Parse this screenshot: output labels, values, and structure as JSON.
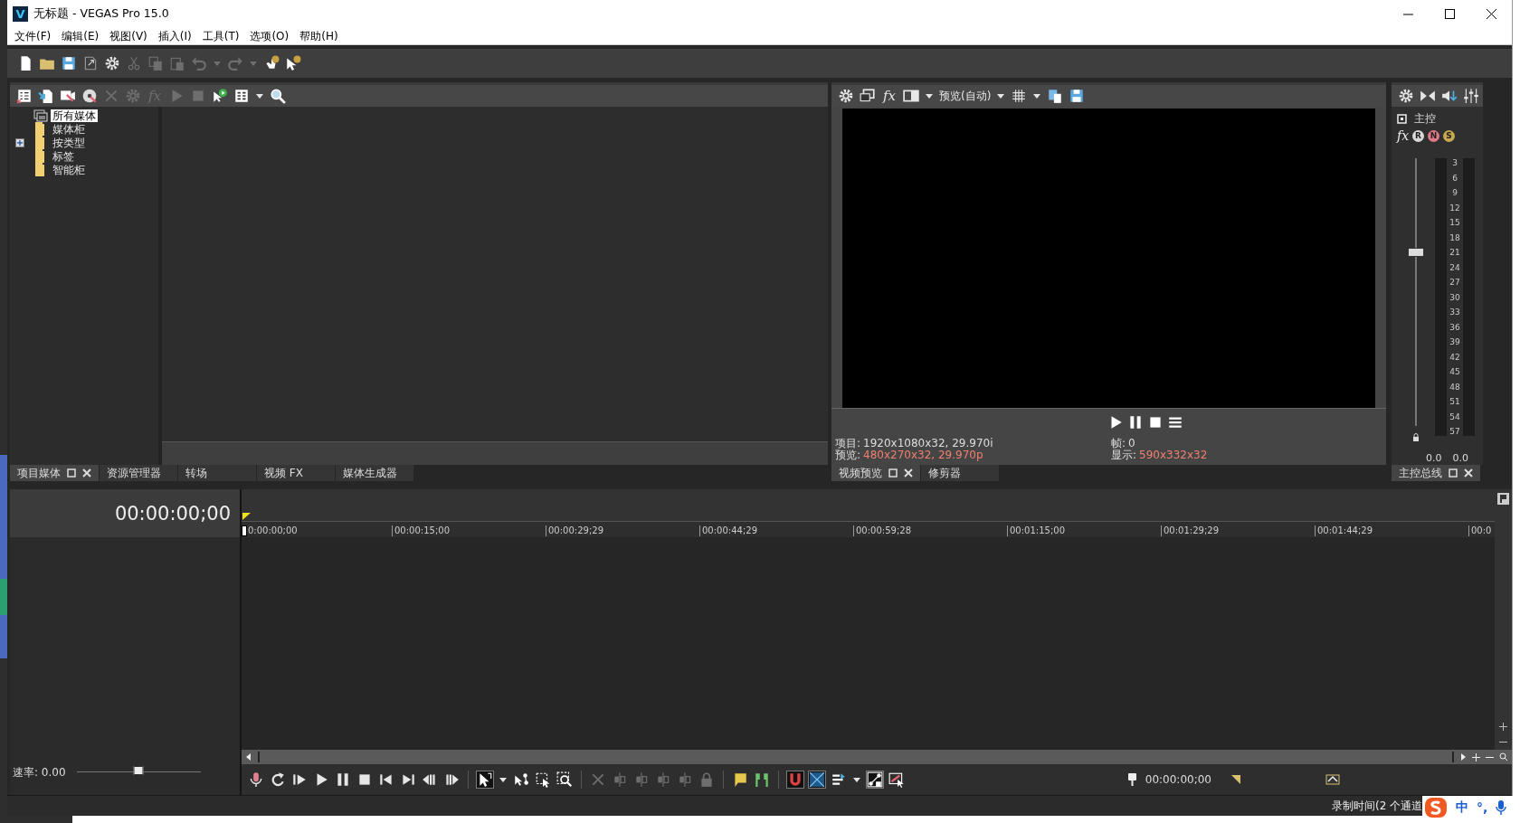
{
  "window": {
    "logo": "V",
    "title": "无标题 - VEGAS Pro 15.0"
  },
  "menu": [
    "文件(F)",
    "编辑(E)",
    "视图(V)",
    "插入(I)",
    "工具(T)",
    "选项(O)",
    "帮助(H)"
  ],
  "main_toolbar": [
    {
      "kind": "new",
      "disabled": false
    },
    {
      "kind": "open",
      "disabled": false
    },
    {
      "kind": "save",
      "disabled": false
    },
    {
      "kind": "render",
      "disabled": false
    },
    {
      "kind": "gear",
      "disabled": false
    },
    {
      "kind": "cut",
      "disabled": true
    },
    {
      "kind": "copy",
      "disabled": true
    },
    {
      "kind": "paste",
      "disabled": true
    },
    {
      "kind": "undo",
      "disabled": true
    },
    {
      "kind": "caret",
      "disabled": true
    },
    {
      "kind": "redo",
      "disabled": true
    },
    {
      "kind": "caret",
      "disabled": true
    },
    {
      "kind": "helphand",
      "disabled": false
    },
    {
      "kind": "helpptr",
      "disabled": false
    }
  ],
  "media_panel": {
    "toolbar": [
      {
        "kind": "list",
        "disabled": false
      },
      {
        "kind": "import",
        "disabled": false
      },
      {
        "kind": "capture",
        "disabled": false
      },
      {
        "kind": "disc",
        "disabled": false
      },
      {
        "kind": "delete",
        "disabled": true
      },
      {
        "kind": "gear",
        "disabled": true
      },
      {
        "kind": "fx",
        "label": "fx",
        "disabled": true
      },
      {
        "kind": "play",
        "disabled": true
      },
      {
        "kind": "stop",
        "disabled": true
      },
      {
        "kind": "autopreview",
        "disabled": false
      },
      {
        "kind": "views",
        "disabled": false
      },
      {
        "kind": "caret",
        "disabled": false
      },
      {
        "kind": "search",
        "disabled": false
      }
    ],
    "tree": [
      {
        "label": "所有媒体",
        "kind": "root",
        "selected": true
      },
      {
        "label": "媒体柜",
        "kind": "folder",
        "selected": false
      },
      {
        "label": "按类型",
        "kind": "folder",
        "selected": false,
        "expanded": false
      },
      {
        "label": "标签",
        "kind": "folder",
        "selected": false
      },
      {
        "label": "智能柜",
        "kind": "folder",
        "selected": false
      }
    ],
    "tabs": [
      {
        "label": "项目媒体",
        "selected": true
      },
      {
        "label": "资源管理器",
        "selected": false
      },
      {
        "label": "转场",
        "selected": false
      },
      {
        "label": "视频 FX",
        "selected": false
      },
      {
        "label": "媒体生成器",
        "selected": false
      }
    ]
  },
  "preview_panel": {
    "toolbar": [
      {
        "kind": "gear"
      },
      {
        "kind": "monitor"
      },
      {
        "kind": "fx",
        "label": "fx"
      },
      {
        "kind": "split"
      },
      {
        "kind": "caret"
      },
      {
        "kind": "menu",
        "label": "预览(自动)"
      },
      {
        "kind": "caret"
      },
      {
        "kind": "grid"
      },
      {
        "kind": "caret"
      },
      {
        "kind": "pages"
      },
      {
        "kind": "save"
      }
    ],
    "transport": [
      {
        "kind": "play"
      },
      {
        "kind": "pause"
      },
      {
        "kind": "stop"
      },
      {
        "kind": "hamburger"
      }
    ],
    "info": [
      {
        "label": "项目:",
        "value": "1920x1080x32, 29.970i",
        "highlight": false
      },
      {
        "label": "帧:",
        "value": "0",
        "highlight": false
      },
      {
        "label": "预览:",
        "value": "480x270x32, 29.970p",
        "highlight": true
      },
      {
        "label": "显示:",
        "value": "590x332x32",
        "highlight": true
      }
    ],
    "tabs": [
      {
        "label": "视频预览",
        "selected": true
      },
      {
        "label": "修剪器",
        "selected": false
      }
    ]
  },
  "master_panel": {
    "toolbar": [
      {
        "kind": "gear"
      },
      {
        "kind": "bowtie"
      },
      {
        "kind": "speaker"
      },
      {
        "kind": "mixer"
      }
    ],
    "title": "主控",
    "effects": [
      {
        "label": "fx"
      },
      {
        "label": "R",
        "color": "#d8d8d8"
      },
      {
        "label": "N",
        "color": "#e07888"
      },
      {
        "label": "S",
        "color": "#c8a850"
      }
    ],
    "scale": [
      "3",
      "6",
      "9",
      "12",
      "15",
      "18",
      "21",
      "24",
      "27",
      "30",
      "33",
      "36",
      "39",
      "42",
      "45",
      "48",
      "51",
      "54",
      "57"
    ],
    "fader": {
      "level": 0.65
    },
    "readings": [
      "0.0",
      "0.0"
    ],
    "tabs": [
      {
        "label": "主控总线",
        "selected": true
      }
    ]
  },
  "timeline": {
    "time": "00:00:00;00",
    "ruler": [
      "0:00:00;00",
      "00:00:15;00",
      "00:00:29;29",
      "00:00:44;29",
      "00:00:59;28",
      "00:01:15;00",
      "00:01:29;29",
      "00:01:44;29",
      "00:0"
    ],
    "speed": {
      "label": "速率: 0.00",
      "level": 0.5
    },
    "transport": [
      {
        "kind": "record",
        "disabled": false,
        "on": false
      },
      {
        "kind": "loop",
        "disabled": false,
        "on": false
      },
      {
        "kind": "playstart",
        "disabled": false,
        "on": false
      },
      {
        "kind": "play",
        "disabled": false,
        "on": false
      },
      {
        "kind": "pause",
        "disabled": false,
        "on": false
      },
      {
        "kind": "stop",
        "disabled": false,
        "on": false
      },
      {
        "kind": "prev",
        "disabled": false,
        "on": false
      },
      {
        "kind": "next",
        "disabled": false,
        "on": false
      },
      {
        "kind": "prevframe",
        "disabled": false,
        "on": false
      },
      {
        "kind": "nextframe",
        "disabled": false,
        "on": false
      },
      {
        "kind": "separator"
      },
      {
        "kind": "edittool",
        "disabled": false,
        "on": true
      },
      {
        "kind": "caret",
        "disabled": false,
        "on": false
      },
      {
        "kind": "envelope",
        "disabled": false,
        "on": false
      },
      {
        "kind": "selection",
        "disabled": false,
        "on": false
      },
      {
        "kind": "zoomtool",
        "disabled": false,
        "on": false
      },
      {
        "kind": "separator"
      },
      {
        "kind": "delete",
        "disabled": true,
        "on": false
      },
      {
        "kind": "trim",
        "disabled": true,
        "on": false
      },
      {
        "kind": "trim",
        "disabled": true,
        "on": false
      },
      {
        "kind": "trim",
        "disabled": true,
        "on": false
      },
      {
        "kind": "trim",
        "disabled": true,
        "on": false
      },
      {
        "kind": "lock",
        "disabled": true,
        "on": false
      },
      {
        "kind": "separator"
      },
      {
        "kind": "marker",
        "disabled": false,
        "on": false
      },
      {
        "kind": "region",
        "disabled": false,
        "on": false
      },
      {
        "kind": "separator"
      },
      {
        "kind": "snap",
        "disabled": false,
        "on": true
      },
      {
        "kind": "xfade",
        "disabled": false,
        "on": true
      },
      {
        "kind": "ripple",
        "disabled": false,
        "on": false
      },
      {
        "kind": "caret",
        "disabled": false,
        "on": false
      },
      {
        "kind": "lockenv",
        "disabled": false,
        "on": true
      },
      {
        "kind": "autoxfade",
        "disabled": false,
        "on": false
      }
    ],
    "cursor_time": "00:00:00;00"
  },
  "status_bar": {
    "text": "录制时间(2 个通道"
  },
  "ime_bar": {
    "mode": "中",
    "punctuation": "°,"
  }
}
